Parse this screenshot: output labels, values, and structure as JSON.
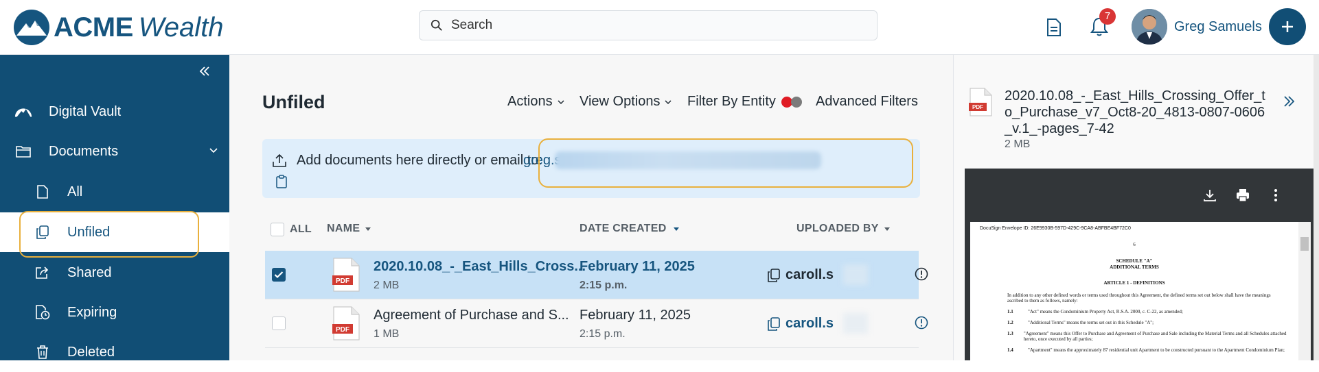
{
  "brand": {
    "name_bold": "ACME",
    "name_italic": "Wealth"
  },
  "header": {
    "search_placeholder": "Search",
    "notifications_count": "7",
    "user_name": "Greg Samuels"
  },
  "sidebar": {
    "items": [
      {
        "label": "Digital Vault",
        "icon": "mountain-icon"
      },
      {
        "label": "Documents",
        "icon": "folder-icon"
      },
      {
        "label": "All",
        "icon": "file-icon"
      },
      {
        "label": "Unfiled",
        "icon": "copy-icon"
      },
      {
        "label": "Shared",
        "icon": "share-icon"
      },
      {
        "label": "Expiring",
        "icon": "file-clock-icon"
      },
      {
        "label": "Deleted",
        "icon": "trash-icon"
      }
    ]
  },
  "main": {
    "title": "Unfiled",
    "toolbar": {
      "actions": "Actions",
      "view_options": "View Options",
      "filter_entity": "Filter By Entity",
      "advanced_filters": "Advanced Filters"
    },
    "dropzone": {
      "text": "Add documents here directly or email to:",
      "email_prefix": "greg.s"
    },
    "table": {
      "headers": {
        "all": "ALL",
        "name": "NAME",
        "date_created": "DATE CREATED",
        "uploaded_by": "UPLOADED BY"
      },
      "rows": [
        {
          "name": "2020.10.08_-_East_Hills_Cross...",
          "size": "2 MB",
          "date": "February 11, 2025",
          "time": "2:15 p.m.",
          "uploader": "caroll.s",
          "selected": true
        },
        {
          "name": "Agreement of Purchase and S...",
          "size": "1 MB",
          "date": "February 11, 2025",
          "time": "2:15 p.m.",
          "uploader": "caroll.s",
          "selected": false
        }
      ]
    }
  },
  "preview": {
    "file_name": "2020.10.08_-_East_Hills_Crossing_Offer_to_Purchase_v7_Oct8-20_4813-0807-0606_v.1_-pages_7-42",
    "file_size": "2 MB",
    "doc": {
      "envelope": "DocuSign Envelope ID: 26E9930B-597D-429C-9CA8-ABFBE4BF72C0",
      "page_number": "6",
      "schedule": "SCHEDULE \"A\"",
      "schedule_sub": "ADDITIONAL TERMS",
      "article": "ARTICLE 1 - DEFINITIONS",
      "intro": "In addition to any other defined words or terms used throughout this Agreement, the defined terms set out below shall have the meanings ascribed to them as follows, namely:",
      "defs": [
        {
          "n": "1.1",
          "t": "\"Act\" means the Condominium Property Act, R.S.A. 2000, c. C-22, as amended;"
        },
        {
          "n": "1.2",
          "t": "\"Additional Terms\" means the terms set out in this Schedule \"A\";"
        },
        {
          "n": "1.3",
          "t": "\"Agreement\" means this Offer to Purchase and Agreement of Purchase and Sale including the Material Terms and all Schedules attached hereto, once executed by all parties;"
        },
        {
          "n": "1.4",
          "t": "\"Apartment\" means the approximately 87 residential unit Apartment to be constructed pursuant to the Apartment Condominium Plan;"
        }
      ]
    }
  },
  "colors": {
    "brand": "#114e75",
    "accent_text": "#16557f",
    "highlight": "#e9b03c",
    "selected_row": "#c7e1f6",
    "badge": "#d93535"
  }
}
